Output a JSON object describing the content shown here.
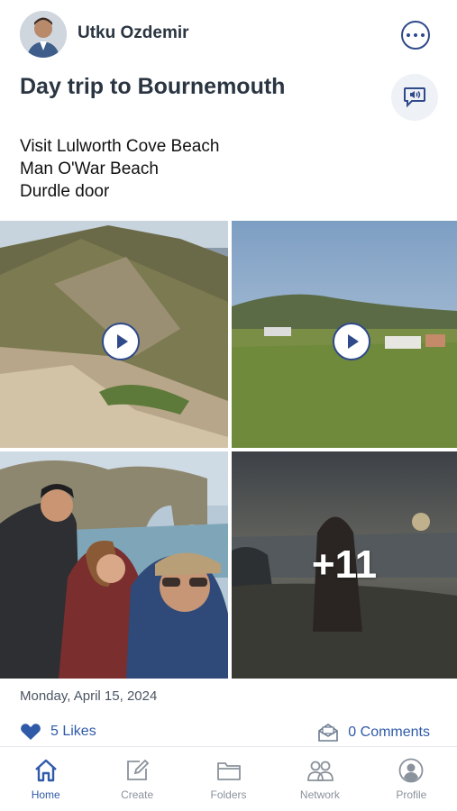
{
  "post": {
    "author": "Utku Ozdemir",
    "title": "Day trip to Bournemouth",
    "description_lines": [
      "Visit Lulworth Cove Beach",
      "Man O'War Beach",
      "Durdle door"
    ],
    "date": "Monday, April 15, 2024",
    "more_media_count": "+11",
    "likes": "5 Likes",
    "comments": "0 Comments"
  },
  "media": [
    {
      "kind": "video",
      "icon": "play-icon"
    },
    {
      "kind": "video",
      "icon": "play-icon"
    },
    {
      "kind": "photo"
    },
    {
      "kind": "photo"
    }
  ],
  "tabbar": {
    "items": [
      {
        "label": "Home",
        "icon": "home-icon",
        "active": true
      },
      {
        "label": "Create",
        "icon": "edit-icon",
        "active": false
      },
      {
        "label": "Folders",
        "icon": "folder-icon",
        "active": false
      },
      {
        "label": "Network",
        "icon": "people-icon",
        "active": false
      },
      {
        "label": "Profile",
        "icon": "profile-icon",
        "active": false
      }
    ]
  },
  "colors": {
    "accent": "#2f5aa8",
    "text": "#2a3541",
    "inactive": "#8a929c"
  }
}
